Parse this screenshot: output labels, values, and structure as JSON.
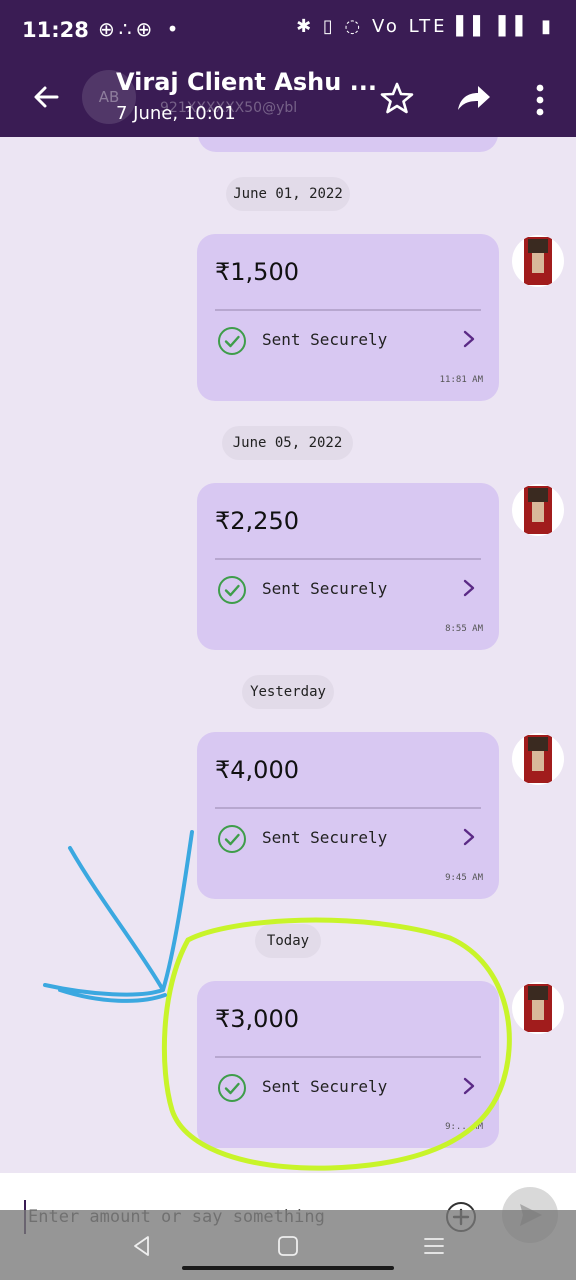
{
  "status_bar": {
    "time": "11:28",
    "left_icons": "⊕∴⊕ •",
    "right_icons": "✱ ▯ ◌ Vo LTE ▌▌ ▌▌ ▮"
  },
  "header": {
    "title": "Viraj Client Ashu ...",
    "subtitle": "7 June, 10:01",
    "ghost_avatar": "AB",
    "ghost_subtitle": "921XXXXXX50@ybl"
  },
  "messages": [
    {
      "date": "June 01, 2022",
      "amount": "₹1,500",
      "status": "Sent Securely",
      "time": "11:81 AM"
    },
    {
      "date": "June 05, 2022",
      "amount": "₹2,250",
      "status": "Sent Securely",
      "time": "8:55 AM"
    },
    {
      "date": "Yesterday",
      "amount": "₹4,000",
      "status": "Sent Securely",
      "time": "9:45 AM"
    },
    {
      "date": "Today",
      "amount": "₹3,000",
      "status": "Sent Securely",
      "time": "9:.. AM"
    }
  ],
  "input": {
    "placeholder": "Enter amount or say something"
  },
  "colors": {
    "header": "#3a1c54",
    "bubble": "#d8c8f2",
    "check": "#3e9d4a",
    "chevron": "#5b2a86",
    "highlight": "#c8f42a",
    "arrow": "#3ba8e0"
  }
}
